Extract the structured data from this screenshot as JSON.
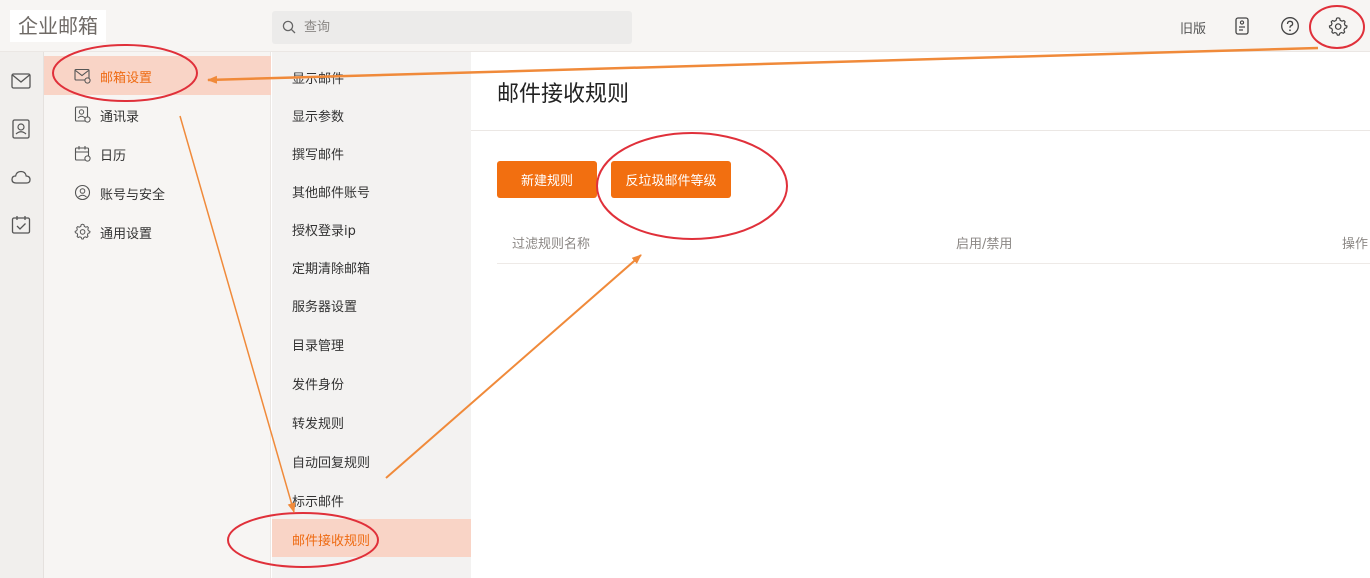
{
  "header": {
    "logo": "企业邮箱",
    "search_placeholder": "查询",
    "old_version": "旧版",
    "icons": [
      "mobile-icon",
      "help-icon",
      "settings-gear-icon"
    ]
  },
  "rail": {
    "icons": [
      "mail-icon",
      "contacts-icon",
      "cloud-icon",
      "calendar-check-icon"
    ]
  },
  "settings_nav": {
    "items": [
      {
        "label": "邮箱设置",
        "icon": "mail-settings-icon",
        "active": true
      },
      {
        "label": "通讯录",
        "icon": "contacts-settings-icon",
        "active": false
      },
      {
        "label": "日历",
        "icon": "calendar-settings-icon",
        "active": false
      },
      {
        "label": "账号与安全",
        "icon": "account-icon",
        "active": false
      },
      {
        "label": "通用设置",
        "icon": "gear-icon",
        "active": false
      }
    ]
  },
  "sub_nav": {
    "items": [
      {
        "label": "显示邮件",
        "active": false
      },
      {
        "label": "显示参数",
        "active": false
      },
      {
        "label": "撰写邮件",
        "active": false
      },
      {
        "label": "其他邮件账号",
        "active": false
      },
      {
        "label": "授权登录ip",
        "active": false
      },
      {
        "label": "定期清除邮箱",
        "active": false
      },
      {
        "label": "服务器设置",
        "active": false
      },
      {
        "label": "目录管理",
        "active": false
      },
      {
        "label": "发件身份",
        "active": false
      },
      {
        "label": "转发规则",
        "active": false
      },
      {
        "label": "自动回复规则",
        "active": false
      },
      {
        "label": "标示邮件",
        "active": false
      },
      {
        "label": "邮件接收规则",
        "active": true
      }
    ]
  },
  "main": {
    "title": "邮件接收规则",
    "new_rule_button": "新建规则",
    "antispam_button": "反垃圾邮件等级",
    "columns": {
      "name": "过滤规则名称",
      "status": "启用/禁用",
      "actions": "操作"
    }
  },
  "colors": {
    "accent": "#f26f10",
    "active_bg": "#f9d4c6",
    "annotation_red": "#e0303a",
    "annotation_orange": "#f08a3a"
  }
}
